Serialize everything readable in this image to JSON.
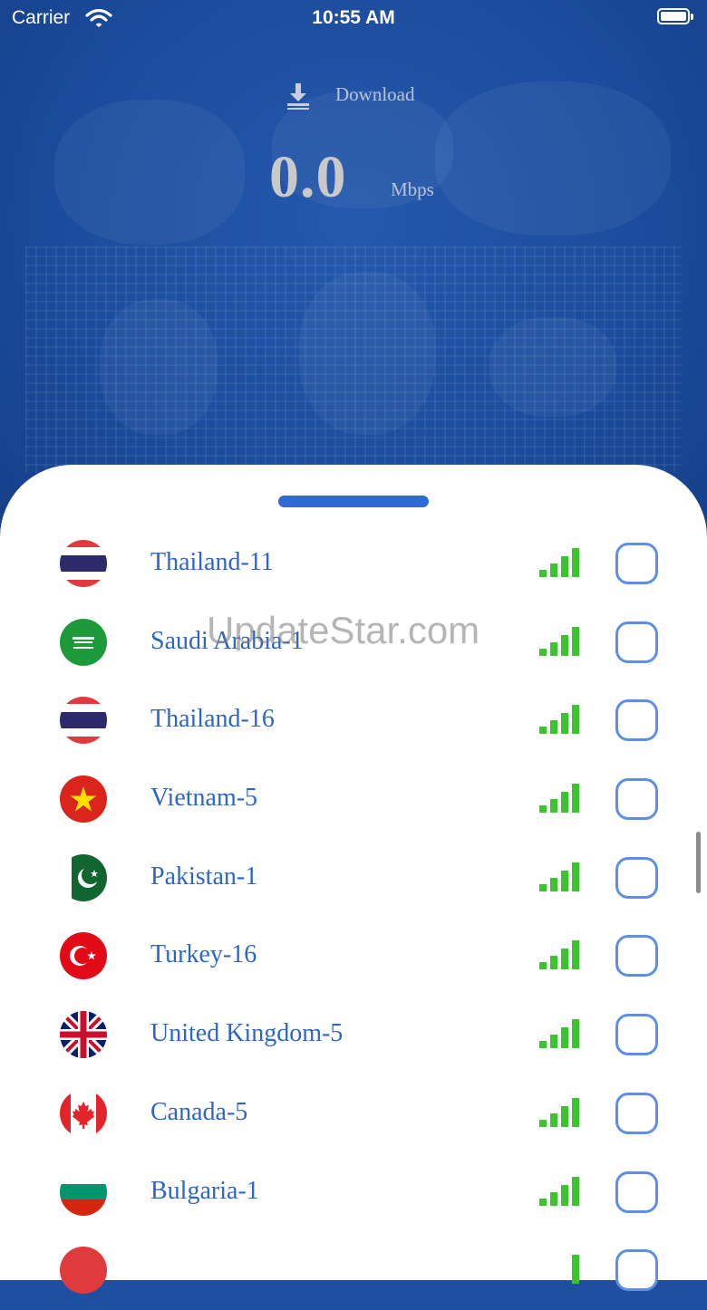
{
  "status_bar": {
    "carrier": "Carrier",
    "time": "10:55 AM"
  },
  "speed": {
    "label": "Download",
    "value": "0.0",
    "unit": "Mbps"
  },
  "servers": [
    {
      "name": "Thailand-11",
      "flag": "thailand-flag-icon"
    },
    {
      "name": "Saudi Arabia-1",
      "flag": "saudi-arabia-flag-icon"
    },
    {
      "name": "Thailand-16",
      "flag": "thailand-flag-icon"
    },
    {
      "name": "Vietnam-5",
      "flag": "vietnam-flag-icon"
    },
    {
      "name": "Pakistan-1",
      "flag": "pakistan-flag-icon"
    },
    {
      "name": "Turkey-16",
      "flag": "turkey-flag-icon"
    },
    {
      "name": "United Kingdom-5",
      "flag": "united-kingdom-flag-icon"
    },
    {
      "name": "Canada-5",
      "flag": "canada-flag-icon"
    },
    {
      "name": "Bulgaria-1",
      "flag": "bulgaria-flag-icon"
    }
  ],
  "watermark": "UpdateStar.com",
  "colors": {
    "accent": "#2f6ad6",
    "country_text": "#2d66c6",
    "signal": "#3cc42f",
    "hero_bg": "#1e4fa0"
  }
}
